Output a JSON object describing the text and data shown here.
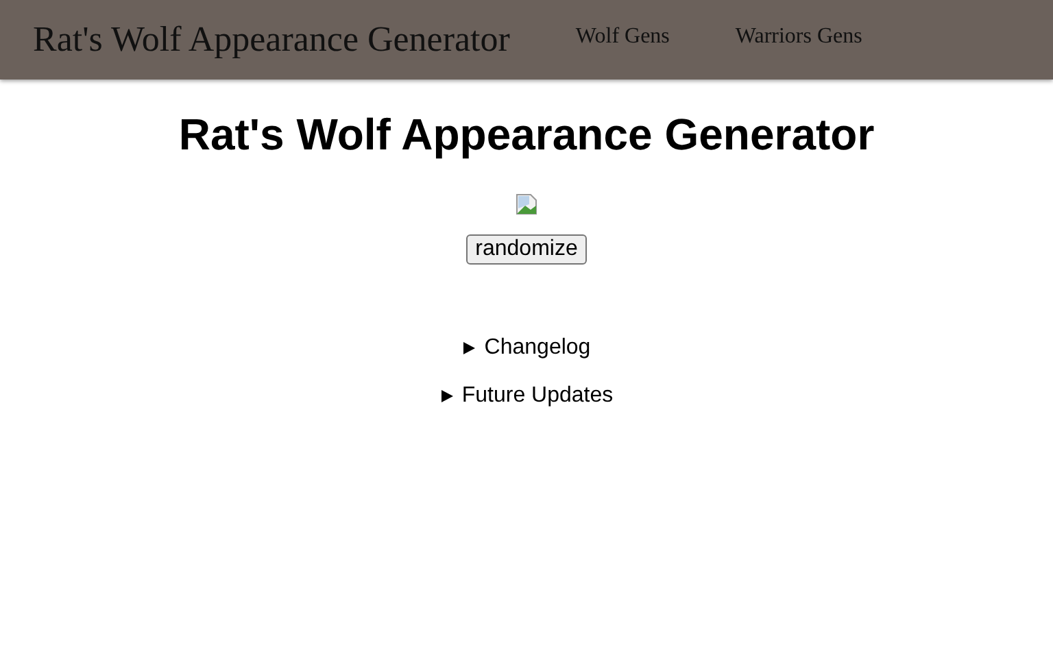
{
  "navbar": {
    "brand": "Rat's Wolf Appearance Generator",
    "links": [
      {
        "label": "Wolf Gens"
      },
      {
        "label": "Warriors Gens"
      }
    ]
  },
  "heading": "Rat's Wolf Appearance Generator",
  "button": "randomize",
  "sections": [
    {
      "expanded": false,
      "label": "Changelog"
    },
    {
      "expanded": false,
      "label": "Future Updates"
    }
  ]
}
